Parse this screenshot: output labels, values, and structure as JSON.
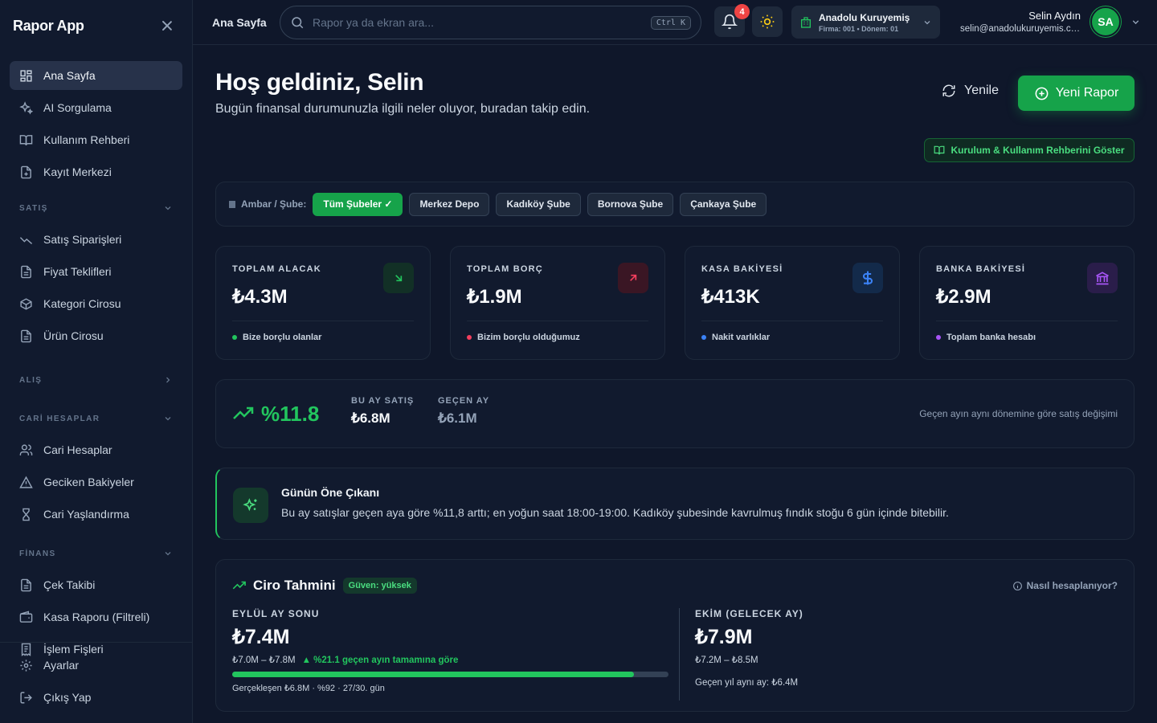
{
  "app": {
    "name": "Rapor App"
  },
  "sidebar": {
    "top_items": [
      {
        "label": "Ana Sayfa"
      },
      {
        "label": "AI Sorgulama"
      },
      {
        "label": "Kullanım Rehberi"
      },
      {
        "label": "Kayıt Merkezi"
      }
    ],
    "sections": [
      {
        "title": "SATIŞ",
        "items": [
          "Satış Siparişleri",
          "Fiyat Teklifleri",
          "Kategori Cirosu",
          "Ürün Cirosu"
        ]
      },
      {
        "title": "ALIŞ",
        "items": []
      },
      {
        "title": "CARİ HESAPLAR",
        "items": [
          "Cari Hesaplar",
          "Geciken Bakiyeler",
          "Cari Yaşlandırma"
        ]
      },
      {
        "title": "FİNANS",
        "items": [
          "Çek Takibi",
          "Kasa Raporu (Filtreli)",
          "İşlem Fişleri"
        ]
      }
    ],
    "bottom_items": [
      {
        "label": "Ayarlar"
      },
      {
        "label": "Çıkış Yap"
      }
    ]
  },
  "topbar": {
    "breadcrumb": "Ana Sayfa",
    "search_placeholder": "Rapor ya da ekran ara...",
    "shortcut": "Ctrl K",
    "notification_count": "4",
    "company_name": "Anadolu Kuruyemiş",
    "company_sub": "Firma: 001 • Dönem: 01",
    "user_name": "Selin Aydın",
    "user_email": "selin@anadolukuruyemis.com",
    "user_initials": "SA"
  },
  "header": {
    "title": "Hoş geldiniz, Selin",
    "subtitle": "Bugün finansal durumunuzla ilgili neler oluyor, buradan takip edin.",
    "refresh_label": "Yenile",
    "new_report_label": "Yeni Rapor",
    "guide_label": "Kurulum & Kullanım Rehberini Göster"
  },
  "filters": {
    "label": "Ambar / Şube:",
    "options": [
      "Tüm Şubeler ✓",
      "Merkez Depo",
      "Kadıköy Şube",
      "Bornova Şube",
      "Çankaya Şube"
    ],
    "selected_index": 0
  },
  "kpis": [
    {
      "label": "TOPLAM ALACAK",
      "value": "₺4.3M",
      "note": "Bize borçlu olanlar",
      "color": "#22c55e",
      "icon": "arrow-down-right-icon"
    },
    {
      "label": "TOPLAM BORÇ",
      "value": "₺1.9M",
      "note": "Bizim borçlu olduğumuz",
      "color": "#f43f5e",
      "icon": "arrow-up-right-icon"
    },
    {
      "label": "KASA BAKİYESİ",
      "value": "₺413K",
      "note": "Nakit varlıklar",
      "color": "#3b82f6",
      "icon": "dollar-icon"
    },
    {
      "label": "BANKA BAKİYESİ",
      "value": "₺2.9M",
      "note": "Toplam banka hesabı",
      "color": "#a855f7",
      "icon": "bank-icon"
    }
  ],
  "trend": {
    "change": "%11.8",
    "this_month_label": "BU AY SATIŞ",
    "this_month_value": "₺6.8M",
    "last_month_label": "GEÇEN AY",
    "last_month_value": "₺6.1M",
    "note": "Geçen ayın aynı dönemine göre satış değişimi"
  },
  "highlight": {
    "title": "Günün Öne Çıkanı",
    "text": "Bu ay satışlar geçen aya göre %11,8 arttı; en yoğun saat 18:00-19:00. Kadıköy şubesinde kavrulmuş fındık stoğu 6 gün içinde bitebilir."
  },
  "forecast": {
    "title": "Ciro Tahmini",
    "confidence": "Güven: yüksek",
    "how_label": "Nasıl hesaplanıyor?",
    "current": {
      "label": "EYLÜL AY SONU",
      "value": "₺7.4M",
      "range": "₺7.0M – ₺7.8M",
      "change": "▲ %21.1 geçen ayın tamamına göre",
      "progress": 0.92,
      "caption": "Gerçekleşen ₺6.8M · %92 · 27/30. gün"
    },
    "next": {
      "label": "EKİM (GELECEK AY)",
      "value": "₺7.9M",
      "range": "₺7.2M – ₺8.5M",
      "caption": "Geçen yıl aynı ay: ₺6.4M"
    }
  }
}
